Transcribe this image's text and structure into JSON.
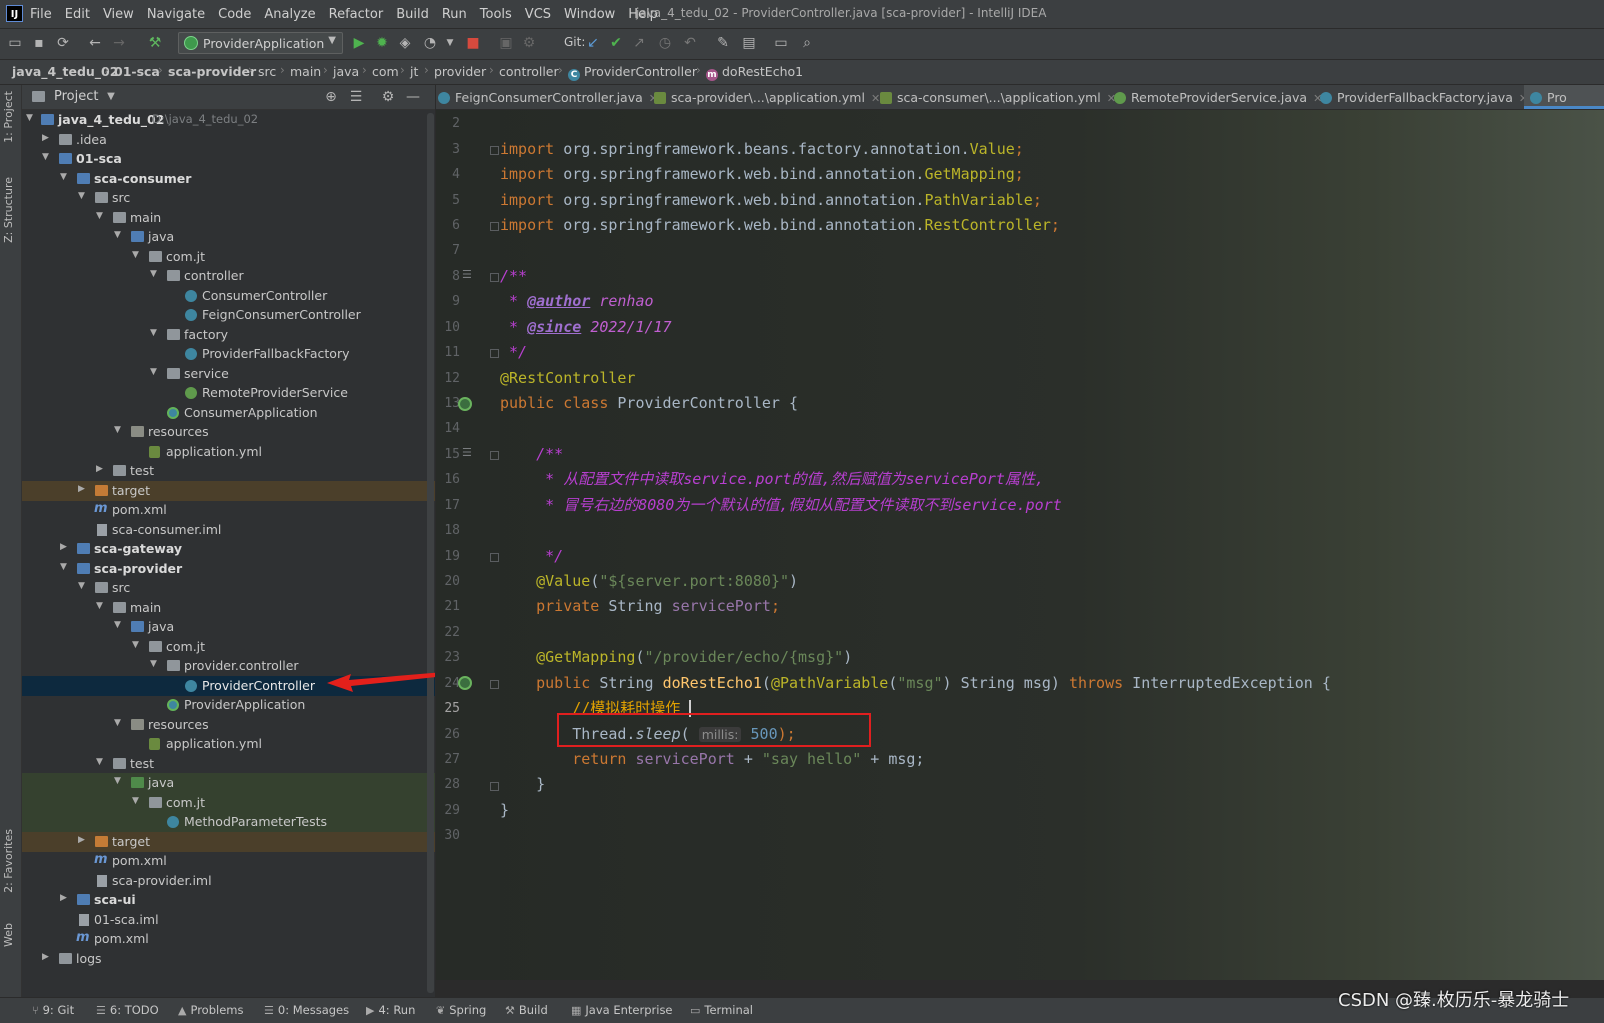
{
  "menu": {
    "items": [
      "File",
      "Edit",
      "View",
      "Navigate",
      "Code",
      "Analyze",
      "Refactor",
      "Build",
      "Run",
      "Tools",
      "VCS",
      "Window",
      "Help"
    ],
    "window_title": "java_4_tedu_02 - ProviderController.java [sca-provider] - IntelliJ IDEA"
  },
  "toolbar": {
    "run_config": "ProviderApplication",
    "git_label": "Git:"
  },
  "breadcrumb": [
    "java_4_tedu_02",
    "01-sca",
    "sca-provider",
    "src",
    "main",
    "java",
    "com",
    "jt",
    "provider",
    "controller",
    "ProviderController",
    "doRestEcho1"
  ],
  "side_tabs": {
    "project": "1: Project",
    "structure": "Z: Structure",
    "favorites": "2: Favorites",
    "web": "Web"
  },
  "project_panel": {
    "title": "Project",
    "tree": [
      {
        "label": "java_4_tedu_02",
        "path": "D:\\java_4_tedu_02",
        "bold": true
      },
      {
        "label": ".idea"
      },
      {
        "label": "01-sca",
        "bold": true
      },
      {
        "label": "sca-consumer",
        "bold": true
      },
      {
        "label": "src"
      },
      {
        "label": "main"
      },
      {
        "label": "java"
      },
      {
        "label": "com.jt"
      },
      {
        "label": "controller"
      },
      {
        "label": "ConsumerController"
      },
      {
        "label": "FeignConsumerController"
      },
      {
        "label": "factory"
      },
      {
        "label": "ProviderFallbackFactory"
      },
      {
        "label": "service"
      },
      {
        "label": "RemoteProviderService"
      },
      {
        "label": "ConsumerApplication"
      },
      {
        "label": "resources"
      },
      {
        "label": "application.yml"
      },
      {
        "label": "test"
      },
      {
        "label": "target"
      },
      {
        "label": "pom.xml"
      },
      {
        "label": "sca-consumer.iml"
      },
      {
        "label": "sca-gateway",
        "bold": true
      },
      {
        "label": "sca-provider",
        "bold": true
      },
      {
        "label": "src"
      },
      {
        "label": "main"
      },
      {
        "label": "java"
      },
      {
        "label": "com.jt"
      },
      {
        "label": "provider.controller"
      },
      {
        "label": "ProviderController"
      },
      {
        "label": "ProviderApplication"
      },
      {
        "label": "resources"
      },
      {
        "label": "application.yml"
      },
      {
        "label": "test"
      },
      {
        "label": "java"
      },
      {
        "label": "com.jt"
      },
      {
        "label": "MethodParameterTests"
      },
      {
        "label": "target"
      },
      {
        "label": "pom.xml"
      },
      {
        "label": "sca-provider.iml"
      },
      {
        "label": "sca-ui",
        "bold": true
      },
      {
        "label": "01-sca.iml"
      },
      {
        "label": "pom.xml"
      },
      {
        "label": "logs"
      }
    ]
  },
  "editor_tabs": [
    {
      "label": "FeignConsumerController.java"
    },
    {
      "label": "sca-provider\\...\\application.yml"
    },
    {
      "label": "sca-consumer\\...\\application.yml"
    },
    {
      "label": "RemoteProviderService.java"
    },
    {
      "label": "ProviderFallbackFactory.java"
    },
    {
      "label": "Pro"
    }
  ],
  "editor": {
    "line_numbers": [
      "2",
      "3",
      "4",
      "5",
      "6",
      "7",
      "8",
      "9",
      "10",
      "11",
      "12",
      "13",
      "14",
      "15",
      "16",
      "17",
      "18",
      "19",
      "20",
      "21",
      "22",
      "23",
      "24",
      "25",
      "26",
      "27",
      "28",
      "29",
      "30"
    ],
    "code": {
      "l3_pkg": "org.springframework.beans.factory.annotation.",
      "l3_cls": "Value",
      "l4_pkg": "org.springframework.web.bind.annotation.",
      "l4_cls": "GetMapping",
      "l5_pkg": "org.springframework.web.bind.annotation.",
      "l5_cls": "PathVariable",
      "l6_pkg": "org.springframework.web.bind.annotation.",
      "l6_cls": "RestController",
      "import_kw": "import",
      "semicolon": ";",
      "l8": "/**",
      "l9_tag": "@author",
      "l9_val": "renhao",
      "l10_tag": "@since",
      "l10_val": "2022/1/17",
      "l11": "*/",
      "l12": "@RestController",
      "l13_kw": "public class",
      "l13_rest": " ProviderController {",
      "l15": "/**",
      "l16": "* 从配置文件中读取service.port的值,然后赋值为servicePort属性,",
      "l17": "* 冒号右边的8080为一个默认的值,假如从配置文件读取不到service.port",
      "l19": "*/",
      "l20_ann": "@Value",
      "l20_open": "(",
      "l20_str": "\"${server.port:8080}\"",
      "l20_close": ")",
      "l21_kw": "private",
      "l21_type": " String ",
      "l21_field": "servicePort",
      "l23_ann": "@GetMapping",
      "l23_open": "(",
      "l23_str": "\"/provider/echo/{msg}\"",
      "l23_close": ")",
      "l24_kw": "public",
      "l24_type": " String ",
      "l24_method": "doRestEcho1",
      "l24_open": "(",
      "l24_ann": "@PathVariable",
      "l24_p1": "(",
      "l24_str": "\"msg\"",
      "l24_p2": ") String msg) ",
      "l24_throws": "throws",
      "l24_rest": " InterruptedException {",
      "l25": "//模拟耗时操作",
      "l26_a": "Thread.",
      "l26_b": "sleep",
      "l26_c": "( ",
      "l26_hint": "millis:",
      "l26_num": "500",
      "l26_d": ");",
      "l27_kw": "return",
      "l27_field": " servicePort",
      "l27_mid": " + ",
      "l27_str": "\"say hello\"",
      "l27_end": " + msg;",
      "l28": "}",
      "l29": "}"
    }
  },
  "bottom_bar": [
    {
      "label": "9: Git"
    },
    {
      "label": "6: TODO"
    },
    {
      "label": "Problems"
    },
    {
      "label": "0: Messages"
    },
    {
      "label": "4: Run"
    },
    {
      "label": "Spring"
    },
    {
      "label": "Build"
    },
    {
      "label": "Java Enterprise"
    },
    {
      "label": "Terminal"
    }
  ],
  "watermark": "CSDN @臻.枚历乐-暴龙骑士",
  "colors": {
    "keyword": "#cc7832",
    "annotation": "#bbb529",
    "string": "#6a8759",
    "doc_comment": "#b83fd0",
    "line_comment": "#e1a100",
    "field": "#9876aa",
    "method": "#ffc66d",
    "highlight_box": "#e01f1f"
  }
}
